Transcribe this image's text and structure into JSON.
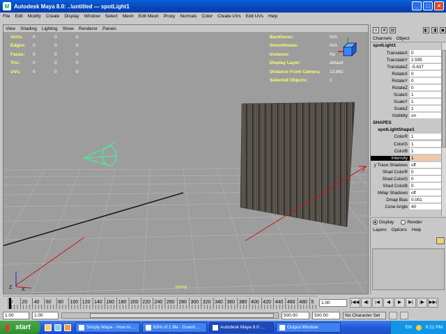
{
  "window": {
    "title": "Autodesk Maya 8.0: ..\\untitled   ---   spotLight1",
    "minimize_glyph": "_",
    "maximize_glyph": "□",
    "close_glyph": "×"
  },
  "menubar": [
    "File",
    "Edit",
    "Modify",
    "Create",
    "Display",
    "Window",
    "Select",
    "Mesh",
    "Edit Mesh",
    "Proxy",
    "Normals",
    "Color",
    "Create UVs",
    "Edit UVs",
    "Help"
  ],
  "panel_menu": [
    "View",
    "Shading",
    "Lighting",
    "Show",
    "Renderer",
    "Panels"
  ],
  "hud_left": [
    {
      "label": "Verts:",
      "a": "0",
      "b": "0",
      "c": "0"
    },
    {
      "label": "Edges:",
      "a": "0",
      "b": "0",
      "c": "0"
    },
    {
      "label": "Faces:",
      "a": "0",
      "b": "0",
      "c": "0"
    },
    {
      "label": "Tris:",
      "a": "0",
      "b": "0",
      "c": "0"
    },
    {
      "label": "UVs:",
      "a": "0",
      "b": "0",
      "c": "0"
    }
  ],
  "hud_right": [
    {
      "label": "Backfaces:",
      "value": "N/A"
    },
    {
      "label": "Smoothness:",
      "value": "N/A"
    },
    {
      "label": "Instance:",
      "value": "No"
    },
    {
      "label": "Display Layer:",
      "value": "default"
    },
    {
      "label": "Distance From Camera:",
      "value": "13.862"
    },
    {
      "label": "Selected Objects:",
      "value": "1"
    }
  ],
  "viewport_camera_label": "persp",
  "axis": {
    "z": "Z",
    "x": "X"
  },
  "channel_box": {
    "tabs": [
      "Channels",
      "Object"
    ],
    "object_name": "spotLight1",
    "transform_attrs": [
      {
        "name": "TranslateX",
        "value": "0"
      },
      {
        "name": "TranslateY",
        "value": "2.595"
      },
      {
        "name": "TranslateZ",
        "value": "-5.637"
      },
      {
        "name": "RotateX",
        "value": "0"
      },
      {
        "name": "RotateY",
        "value": "0"
      },
      {
        "name": "RotateZ",
        "value": "0"
      },
      {
        "name": "ScaleX",
        "value": "1"
      },
      {
        "name": "ScaleY",
        "value": "1"
      },
      {
        "name": "ScaleZ",
        "value": "1"
      },
      {
        "name": "Visibility",
        "value": "on"
      }
    ],
    "shapes_header": "SHAPES",
    "shape_name": "spotLightShape1",
    "shape_attrs": [
      {
        "name": "ColorR",
        "value": "1"
      },
      {
        "name": "ColorG",
        "value": "1"
      },
      {
        "name": "ColorB",
        "value": "1"
      },
      {
        "name": "Intensity",
        "value": "1"
      },
      {
        "name": "y Trace Shadows",
        "value": "off"
      },
      {
        "name": "Shad ColorR",
        "value": "0"
      },
      {
        "name": "Shad ColorG",
        "value": "0"
      },
      {
        "name": "Shad ColorB",
        "value": "0"
      },
      {
        "name": "hMap Shadows",
        "value": "off"
      },
      {
        "name": "Dmap Bias",
        "value": "0.001"
      },
      {
        "name": "Cone Angle",
        "value": "40"
      }
    ]
  },
  "layer_editor": {
    "display_label": "Display",
    "render_label": "Render",
    "menu": [
      "Layers",
      "Options",
      "Help"
    ]
  },
  "timeline": {
    "ticks": [
      "0",
      "20",
      "40",
      "60",
      "80",
      "100",
      "120",
      "140",
      "160",
      "180",
      "200",
      "220",
      "240",
      "260",
      "280",
      "300",
      "320",
      "340",
      "360",
      "380",
      "400",
      "420",
      "440",
      "460",
      "480",
      "5"
    ],
    "current_frame": "1.00",
    "playback_buttons": [
      "|◀◀",
      "◀|",
      "|◀",
      "◀",
      "▶",
      "▶|",
      "|▶",
      "▶▶|"
    ]
  },
  "range_slider": {
    "start_time": "1.00",
    "playback_start": "1.00",
    "playback_end": "500.00",
    "end_time": "500.00",
    "character_set": "No Character Set"
  },
  "taskbar": {
    "start_label": "start",
    "tasks": [
      {
        "label": "Simply Maya - How to ...",
        "active": false
      },
      {
        "label": "63% of 1 file - Downl...",
        "active": false
      },
      {
        "label": "Autodesk Maya 8.0: ...",
        "active": true
      },
      {
        "label": "Output Window",
        "active": false
      }
    ],
    "language": "EN",
    "clock": "8:21 PM"
  },
  "colors": {
    "viewport_bg": "#9d9d9d",
    "hud_label": "#ffff66",
    "light_manip": "#33ff99",
    "direction_line": "#cc1111",
    "highlight": "#f0c8a8"
  }
}
